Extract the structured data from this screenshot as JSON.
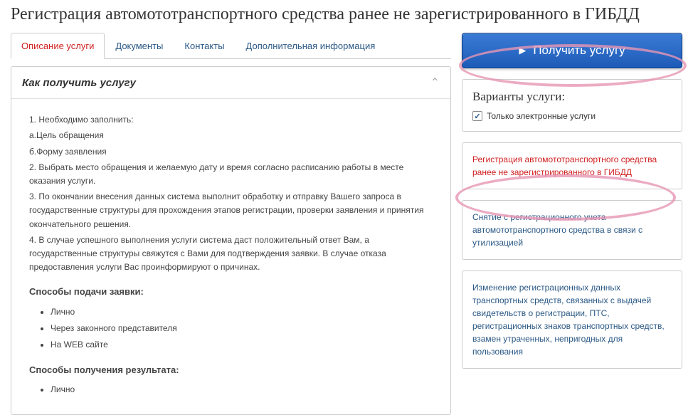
{
  "header": {
    "title": "Регистрация автомототранспортного средства ранее не зарегистрированного в ГИБДД"
  },
  "tabs": [
    {
      "label": "Описание услуги",
      "active": true
    },
    {
      "label": "Документы",
      "active": false
    },
    {
      "label": "Контакты",
      "active": false
    },
    {
      "label": "Дополнительная информация",
      "active": false
    }
  ],
  "accordion": {
    "title": "Как получить услугу"
  },
  "steps": {
    "s1": "1. Необходимо заполнить:",
    "s1a": "а.Цель обращения",
    "s1b": "б.Форму заявления",
    "s2": "2. Выбрать место обращения и желаемую дату и время согласно расписанию работы в месте оказания услуги.",
    "s3": "3. По окончании внесения данных система выполнит обработку и отправку Вашего запроса в государственные структуры для прохождения этапов регистрации, проверки заявления и принятия окончательного решения.",
    "s4": "4. В случае успешного выполнения услуги система даст положительный ответ Вам, а государственные структуры свяжутся с Вами для подтверждения заявки. В случае отказа предоставления услуги Вас проинформируют о причинах."
  },
  "submit_heading": "Способы подачи заявки:",
  "submit_methods": [
    "Лично",
    "Через законного представителя",
    "На WEB сайте"
  ],
  "result_heading": "Способы получения результата:",
  "result_methods": [
    "Лично"
  ],
  "cta": {
    "label": "Получить услугу"
  },
  "variants": {
    "title": "Варианты услуги:",
    "checkbox_label": "Только электронные услуги"
  },
  "related": [
    "Регистрация автомототранспортного средства ранее не зарегистрированного в ГИБДД",
    "Снятие с регистрационного учета автомототранспортного средства в связи с утилизацией",
    "Изменение регистрационных данных транспортных средств, связанных с выдачей свидетельств о регистрации, ПТС, регистрационных знаков транспортных средств, взамен утраченных, непригодных для пользования"
  ]
}
